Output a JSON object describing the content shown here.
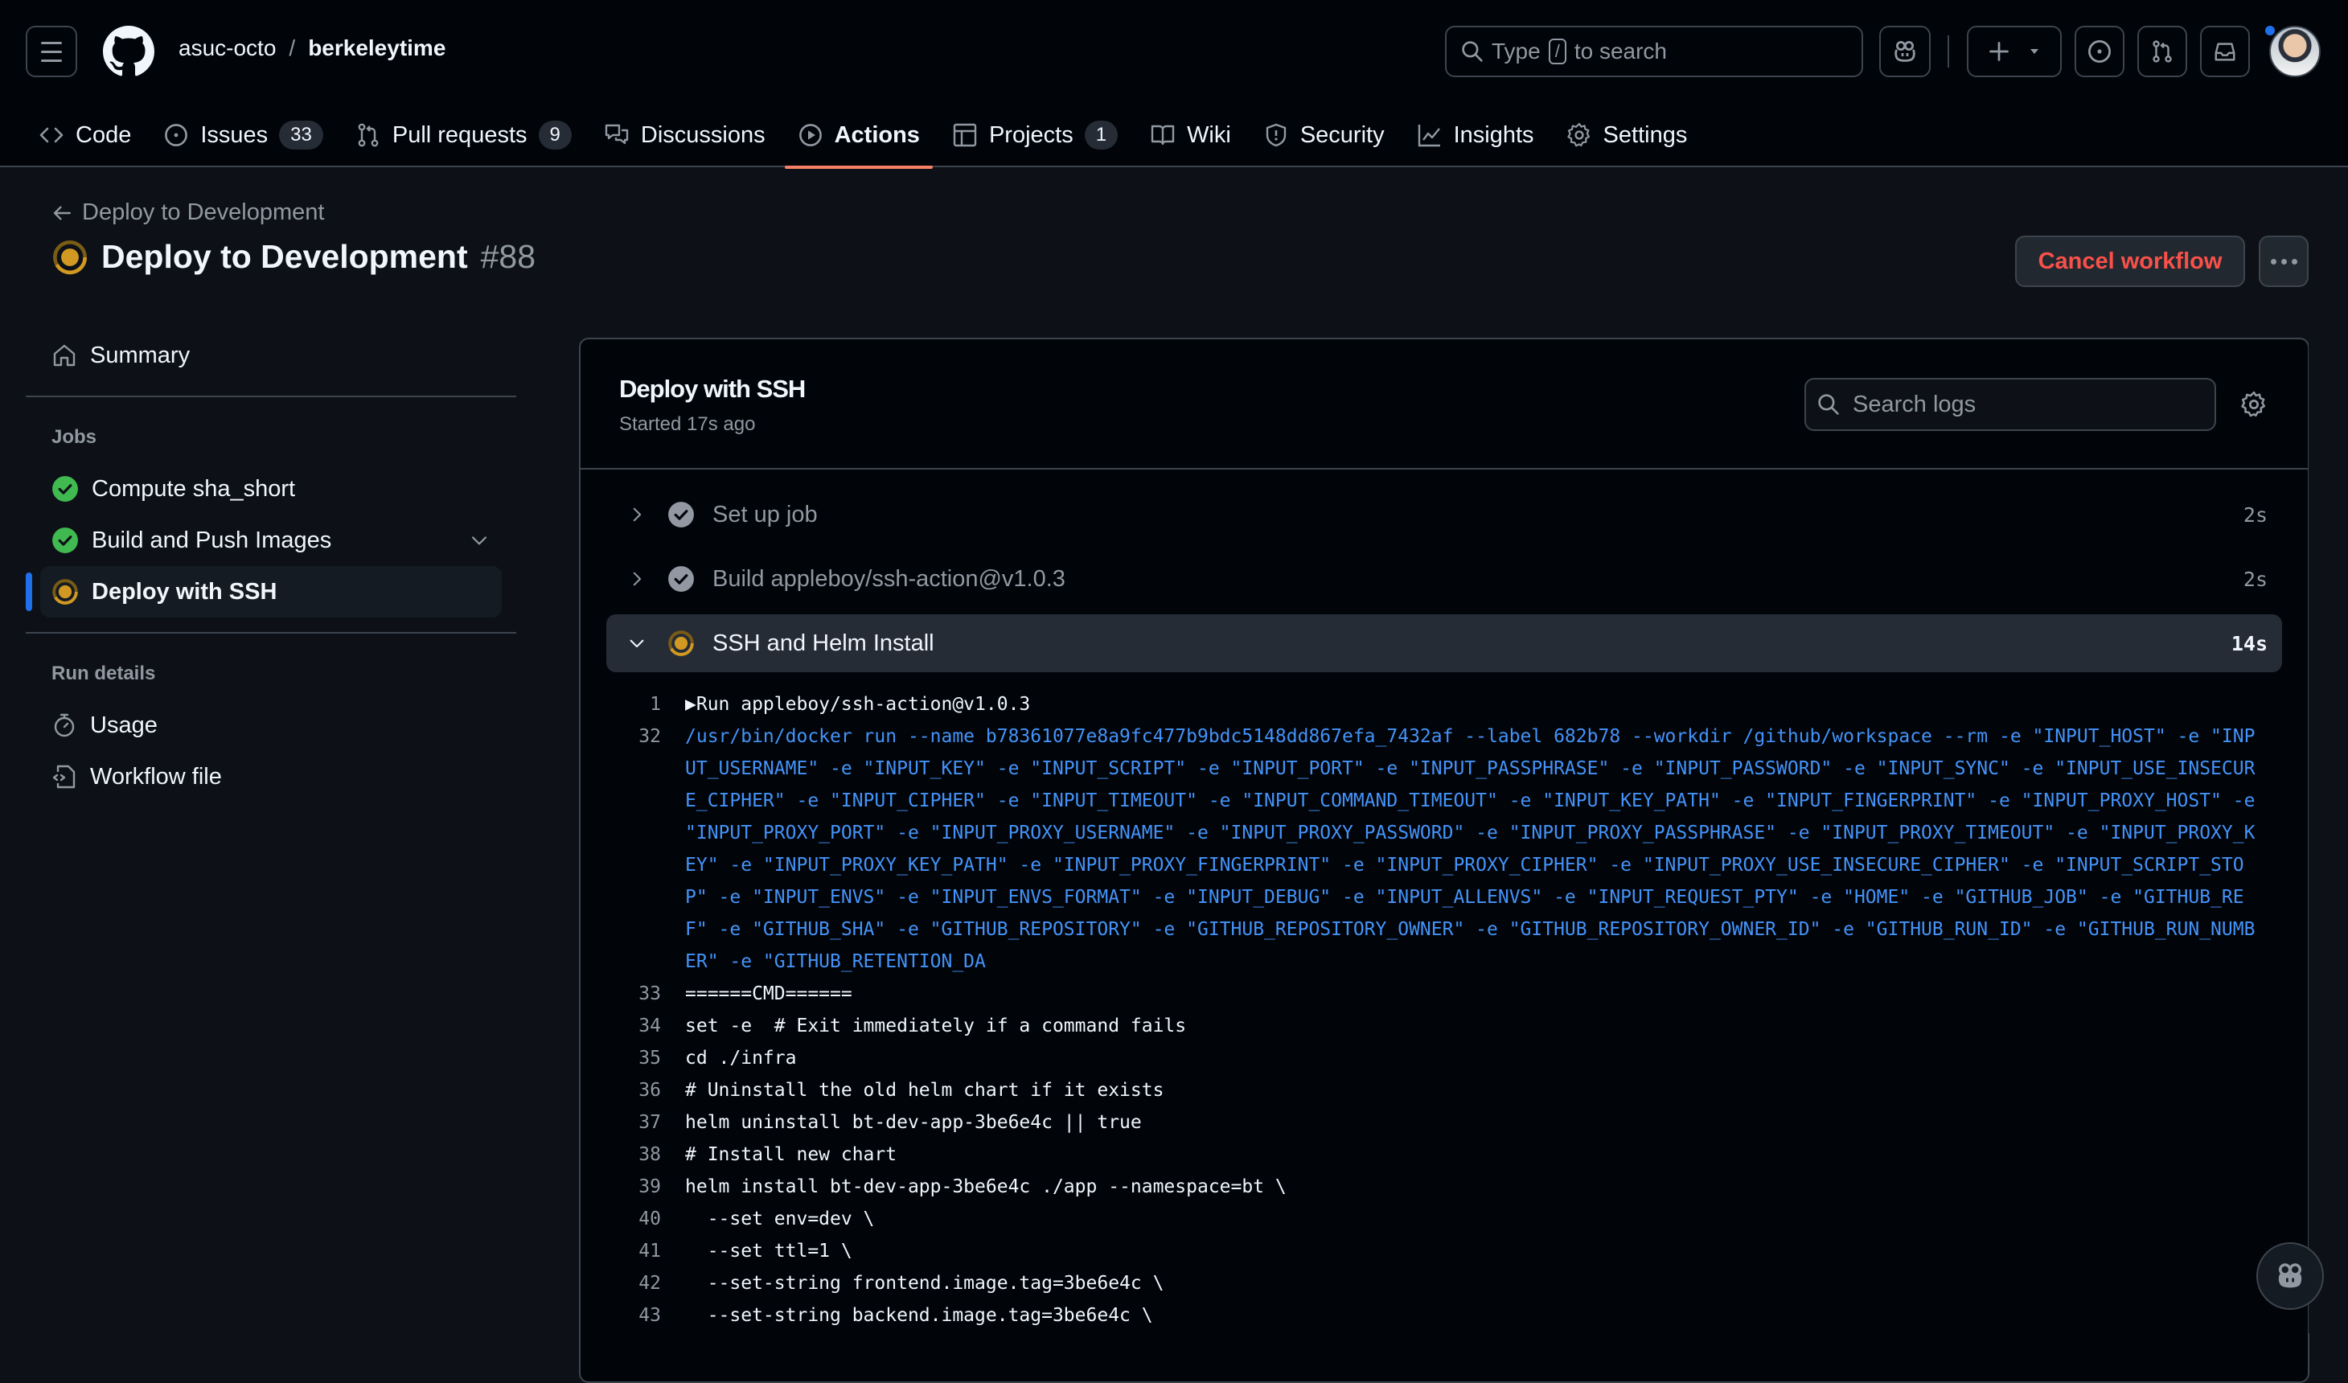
{
  "header": {
    "owner": "asuc-octo",
    "separator": "/",
    "repo": "berkeleytime",
    "search_placeholder_pre": "Type",
    "search_key": "/",
    "search_placeholder_post": "to search"
  },
  "nav": {
    "tabs": [
      {
        "label": "Code",
        "icon": "code-icon"
      },
      {
        "label": "Issues",
        "icon": "issue-opened-icon",
        "count": "33"
      },
      {
        "label": "Pull requests",
        "icon": "git-pull-request-icon",
        "count": "9"
      },
      {
        "label": "Discussions",
        "icon": "comment-discussion-icon"
      },
      {
        "label": "Actions",
        "icon": "play-icon",
        "active": true
      },
      {
        "label": "Projects",
        "icon": "table-icon",
        "count": "1"
      },
      {
        "label": "Wiki",
        "icon": "book-icon"
      },
      {
        "label": "Security",
        "icon": "shield-icon"
      },
      {
        "label": "Insights",
        "icon": "graph-icon"
      },
      {
        "label": "Settings",
        "icon": "gear-icon"
      }
    ]
  },
  "run": {
    "back_label": "Deploy to Development",
    "title": "Deploy to Development",
    "number": "#88",
    "status": "in_progress",
    "cancel_label": "Cancel workflow"
  },
  "sidebar": {
    "summary_label": "Summary",
    "jobs_heading": "Jobs",
    "jobs": [
      {
        "label": "Compute sha_short",
        "status": "success"
      },
      {
        "label": "Build and Push Images",
        "status": "success",
        "expandable": true
      },
      {
        "label": "Deploy with SSH",
        "status": "in_progress",
        "selected": true
      }
    ],
    "run_details_heading": "Run details",
    "usage_label": "Usage",
    "workflow_file_label": "Workflow file"
  },
  "job": {
    "title": "Deploy with SSH",
    "started": "Started 17s ago",
    "search_placeholder": "Search logs",
    "steps": [
      {
        "label": "Set up job",
        "duration": "2s",
        "status": "success",
        "expanded": false
      },
      {
        "label": "Build appleboy/ssh-action@v1.0.3",
        "duration": "2s",
        "status": "success",
        "expanded": false
      },
      {
        "label": "SSH and Helm Install",
        "duration": "14s",
        "status": "in_progress",
        "expanded": true
      }
    ],
    "log_lines": [
      {
        "n": "1",
        "text": "▶Run appleboy/ssh-action@v1.0.3",
        "type": "group"
      },
      {
        "n": "32",
        "text": "/usr/bin/docker run --name b78361077e8a9fc477b9bdc5148dd867efa_7432af --label 682b78 --workdir /github/workspace --rm -e \"INPUT_HOST\" -e \"INPUT_USERNAME\" -e \"INPUT_KEY\" -e \"INPUT_SCRIPT\" -e \"INPUT_PORT\" -e \"INPUT_PASSPHRASE\" -e \"INPUT_PASSWORD\" -e \"INPUT_SYNC\" -e \"INPUT_USE_INSECURE_CIPHER\" -e \"INPUT_CIPHER\" -e \"INPUT_TIMEOUT\" -e \"INPUT_COMMAND_TIMEOUT\" -e \"INPUT_KEY_PATH\" -e \"INPUT_FINGERPRINT\" -e \"INPUT_PROXY_HOST\" -e \"INPUT_PROXY_PORT\" -e \"INPUT_PROXY_USERNAME\" -e \"INPUT_PROXY_PASSWORD\" -e \"INPUT_PROXY_PASSPHRASE\" -e \"INPUT_PROXY_TIMEOUT\" -e \"INPUT_PROXY_KEY\" -e \"INPUT_PROXY_KEY_PATH\" -e \"INPUT_PROXY_FINGERPRINT\" -e \"INPUT_PROXY_CIPHER\" -e \"INPUT_PROXY_USE_INSECURE_CIPHER\" -e \"INPUT_SCRIPT_STOP\" -e \"INPUT_ENVS\" -e \"INPUT_ENVS_FORMAT\" -e \"INPUT_DEBUG\" -e \"INPUT_ALLENVS\" -e \"INPUT_REQUEST_PTY\" -e \"HOME\" -e \"GITHUB_JOB\" -e \"GITHUB_REF\" -e \"GITHUB_SHA\" -e \"GITHUB_REPOSITORY\" -e \"GITHUB_REPOSITORY_OWNER\" -e \"GITHUB_REPOSITORY_OWNER_ID\" -e \"GITHUB_RUN_ID\" -e \"GITHUB_RUN_NUMBER\" -e \"GITHUB_RETENTION_DA",
        "type": "cmd"
      },
      {
        "n": "33",
        "text": "======CMD======",
        "type": "plain"
      },
      {
        "n": "34",
        "text": "set -e  # Exit immediately if a command fails",
        "type": "plain"
      },
      {
        "n": "35",
        "text": "cd ./infra",
        "type": "plain"
      },
      {
        "n": "36",
        "text": "# Uninstall the old helm chart if it exists",
        "type": "plain"
      },
      {
        "n": "37",
        "text": "helm uninstall bt-dev-app-3be6e4c || true",
        "type": "plain"
      },
      {
        "n": "38",
        "text": "# Install new chart",
        "type": "plain"
      },
      {
        "n": "39",
        "text": "helm install bt-dev-app-3be6e4c ./app --namespace=bt \\",
        "type": "plain"
      },
      {
        "n": "40",
        "text": "  --set env=dev \\",
        "type": "plain"
      },
      {
        "n": "41",
        "text": "  --set ttl=1 \\",
        "type": "plain"
      },
      {
        "n": "42",
        "text": "  --set-string frontend.image.tag=3be6e4c \\",
        "type": "plain"
      },
      {
        "n": "43",
        "text": "  --set-string backend.image.tag=3be6e4c \\",
        "type": "plain"
      }
    ]
  },
  "colors": {
    "accent_underline": "#f78166",
    "in_progress": "#d29922",
    "success": "#3fb950",
    "danger": "#f85149",
    "link_blue": "#4493f8",
    "selected_bar": "#1f6feb"
  }
}
